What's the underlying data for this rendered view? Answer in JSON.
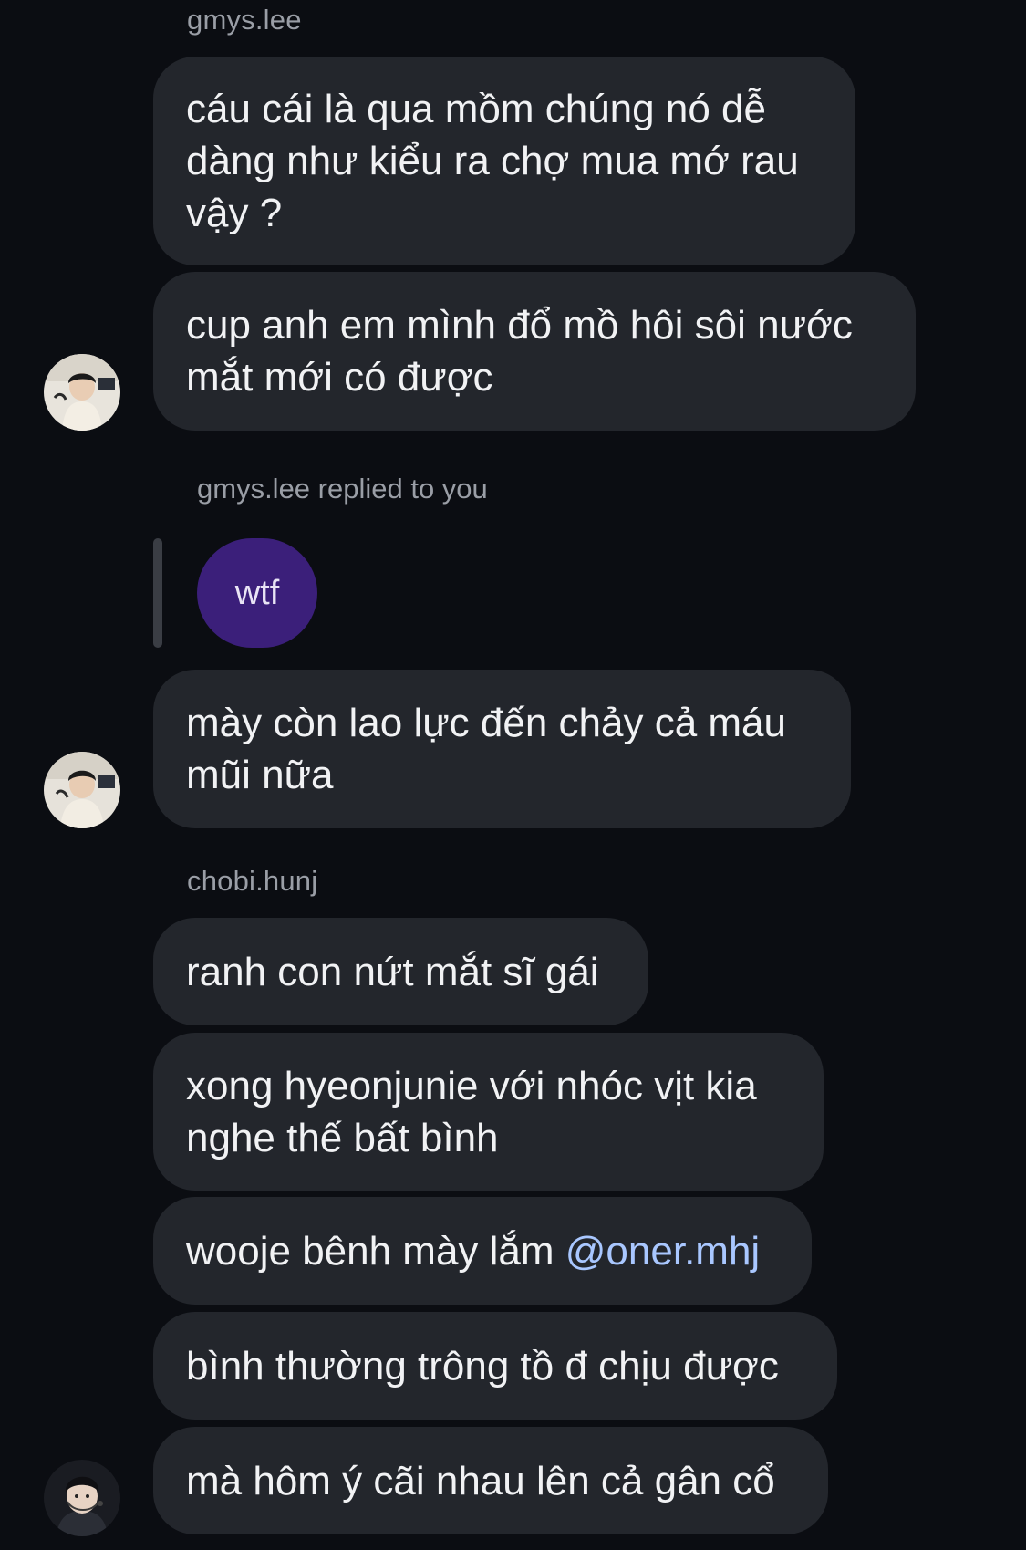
{
  "messages": {
    "sender1": "gmys.lee",
    "m1": [
      "cáu cái là qua mồm chúng nó dễ",
      "dàng như kiểu ra chợ mua mớ rau",
      "vậy ?"
    ],
    "m2": [
      "cup anh em mình đổ mồ hôi sôi nước",
      "mắt mới có được"
    ],
    "reply_label": "gmys.lee replied to you",
    "reply_quote": "wtf",
    "m3": [
      "mày còn lao lực đến chảy cả máu",
      "mũi nữa"
    ],
    "sender2": "chobi.hunj",
    "m4": "ranh con nứt mắt sĩ gái",
    "m5": [
      "xong hyeonjunie với nhóc vịt kia",
      "nghe thế bất bình"
    ],
    "m6_text": "wooje bênh mày lắm ",
    "m6_mention": "@oner.mhj",
    "m7": "bình thường trông tồ đ chịu được",
    "m8": "mà hôm ý cãi nhau lên cả gân cổ"
  },
  "colors": {
    "background": "#0b0d12",
    "bubble": "#23262c",
    "reply_bubble": "#3b1f7a",
    "mention": "#a9c7ff"
  },
  "icons": {
    "avatar1": "user-avatar-photo",
    "avatar2": "user-avatar-photo",
    "avatar3": "user-avatar-photo"
  }
}
